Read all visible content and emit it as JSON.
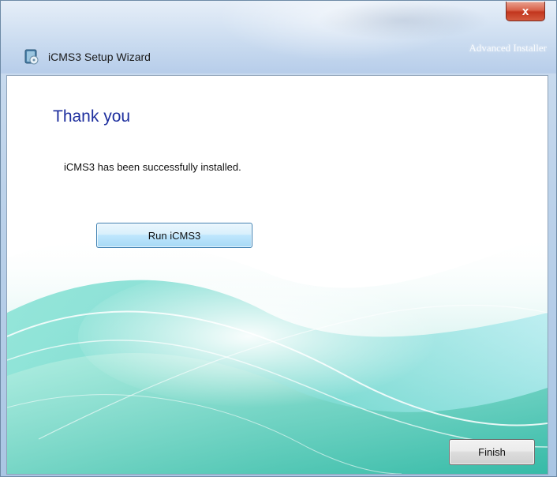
{
  "window": {
    "title": "iCMS3 Setup Wizard",
    "brand": "Advanced Installer",
    "close_label": "x"
  },
  "page": {
    "heading": "Thank you",
    "message": "iCMS3 has been successfully installed."
  },
  "buttons": {
    "run_label": "Run iCMS3",
    "finish_label": "Finish"
  },
  "colors": {
    "heading": "#1e2f9e",
    "close_button": "#c2361e",
    "wave_teal": "#3fc8b8",
    "wave_cyan": "#7fe0e8"
  },
  "icons": {
    "app": "installer-disc-icon",
    "close": "close-icon"
  }
}
